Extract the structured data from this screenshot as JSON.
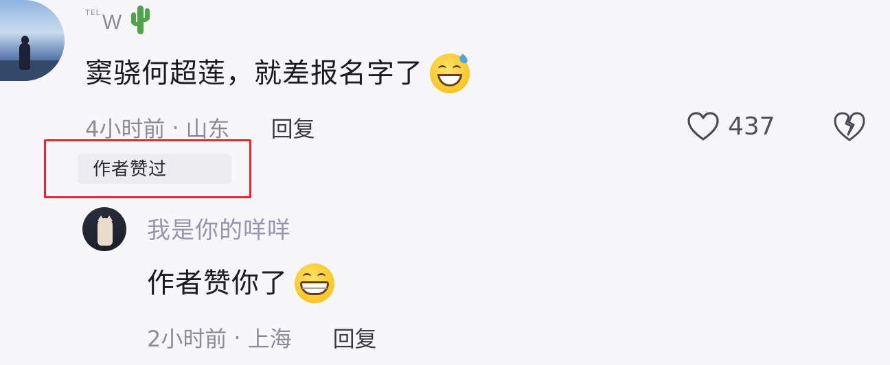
{
  "main_comment": {
    "username_prefix": "TEL",
    "username": "W",
    "username_emoji": "cactus-icon",
    "text": "窦骁何超莲，就差报名字了",
    "text_emoji": "grinning-sweat-icon",
    "time": "4小时前",
    "separator": "·",
    "location": "山东",
    "reply_label": "回复",
    "like_count": "437",
    "author_liked_label": "作者赞过"
  },
  "reply_comment": {
    "username": "我是你的咩咩",
    "text": "作者赞你了",
    "text_emoji": "grinning-face-icon",
    "time": "2小时前",
    "separator": "·",
    "location": "上海",
    "reply_label": "回复"
  },
  "colors": {
    "background": "#f7f7fa",
    "highlight_border": "#e0282e",
    "meta_text": "#8c8c98",
    "reply_username": "#9a93ad"
  }
}
